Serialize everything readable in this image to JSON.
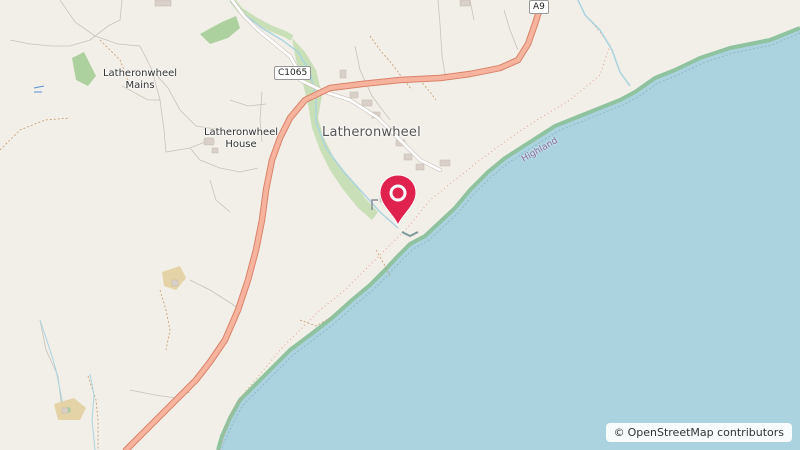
{
  "map": {
    "place_labels": {
      "mains_line1": "Latheronwheel",
      "mains_line2": "Mains",
      "house_line1": "Latheronwheel",
      "house_line2": "House",
      "village": "Latheronwheel"
    },
    "road_refs": {
      "a9": "A9",
      "c1065": "C1065"
    },
    "boundary_label": "Highland",
    "marker": {
      "color": "#e0234e",
      "icon": "map-pin-icon"
    },
    "colors": {
      "land": "#f2efe9",
      "water": "#aad3df",
      "coast_green": "#8fc29e",
      "wood": "#add19e",
      "primary_road": "#f2a285",
      "boundary": "#e8a08f"
    }
  },
  "attribution": {
    "symbol": "©",
    "text": "OpenStreetMap contributors"
  }
}
